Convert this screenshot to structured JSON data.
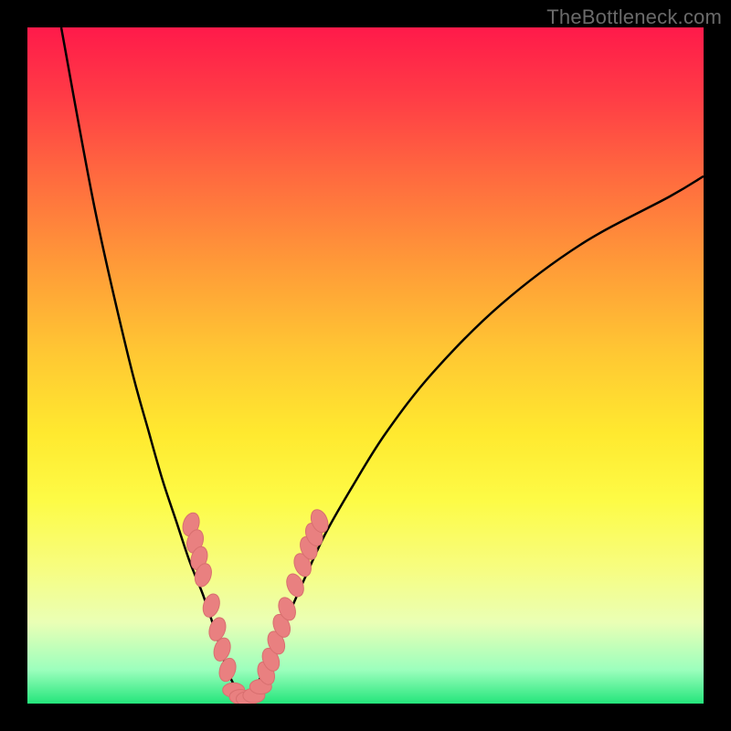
{
  "watermark": "TheBottleneck.com",
  "colors": {
    "dot_fill": "#e98080",
    "dot_stroke": "#d86f6f",
    "curve_stroke": "#000000"
  },
  "chart_data": {
    "type": "line",
    "title": "",
    "xlabel": "",
    "ylabel": "",
    "xlim": [
      0,
      100
    ],
    "ylim": [
      0,
      100
    ],
    "series": [
      {
        "name": "left-limb",
        "x": [
          5,
          10,
          15,
          18,
          20,
          22,
          24,
          26,
          28,
          29.5,
          31,
          32
        ],
        "values": [
          100,
          73,
          51,
          40,
          33,
          27,
          21,
          16,
          10,
          5,
          2,
          0.5
        ]
      },
      {
        "name": "right-limb",
        "x": [
          32,
          33.5,
          35,
          37,
          39,
          41,
          44,
          48,
          53,
          60,
          70,
          82,
          95,
          100
        ],
        "values": [
          0.5,
          2,
          5,
          9.5,
          14,
          18.5,
          25,
          32,
          40,
          49,
          59,
          68,
          75,
          78
        ]
      }
    ],
    "markers": {
      "left_branch": [
        {
          "x": 24.2,
          "y": 26.5
        },
        {
          "x": 24.8,
          "y": 24.0
        },
        {
          "x": 25.4,
          "y": 21.5
        },
        {
          "x": 26.0,
          "y": 19.0
        },
        {
          "x": 27.2,
          "y": 14.5
        },
        {
          "x": 28.1,
          "y": 11.0
        },
        {
          "x": 28.8,
          "y": 8.0
        },
        {
          "x": 29.6,
          "y": 5.0
        }
      ],
      "bottom": [
        {
          "x": 30.5,
          "y": 2.0
        },
        {
          "x": 31.5,
          "y": 1.0
        },
        {
          "x": 32.5,
          "y": 0.7
        },
        {
          "x": 33.5,
          "y": 1.2
        },
        {
          "x": 34.5,
          "y": 2.5
        }
      ],
      "right_branch": [
        {
          "x": 35.3,
          "y": 4.5
        },
        {
          "x": 36.0,
          "y": 6.5
        },
        {
          "x": 36.8,
          "y": 9.0
        },
        {
          "x": 37.6,
          "y": 11.5
        },
        {
          "x": 38.4,
          "y": 14.0
        },
        {
          "x": 39.6,
          "y": 17.5
        },
        {
          "x": 40.7,
          "y": 20.5
        },
        {
          "x": 41.6,
          "y": 23.0
        },
        {
          "x": 42.4,
          "y": 25.0
        },
        {
          "x": 43.2,
          "y": 27.0
        }
      ]
    }
  }
}
